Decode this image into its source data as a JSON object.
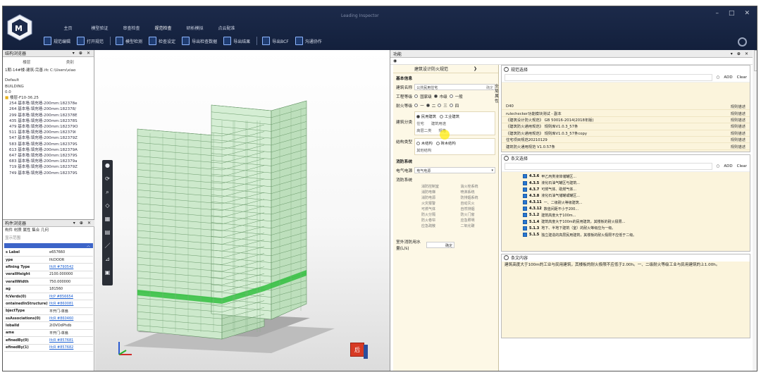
{
  "app": {
    "window_title": "Leading Inspector",
    "menu": [
      "主页",
      "模型验证",
      "审查检查",
      "规范检查",
      "研析模拟",
      "点云配准"
    ],
    "active_menu_index": 3,
    "toolbar": [
      "规范编辑",
      "打开规范",
      "模型检测",
      "检查设定",
      "导出检查数据",
      "导出结果",
      "导出BCF",
      "沟通协作"
    ]
  },
  "left": {
    "tree_title": "结构浏览器",
    "tabs": [
      "楼层",
      "类别"
    ],
    "file_row": "1期-14#楼-建筑-完善.ifc C:\\Users\\xiao",
    "rows": [
      "Default",
      "BUILDING",
      "0.0"
    ],
    "folder": "楼层-F10-36.25",
    "items": [
      "254 基本墙:填充墙-200mm:182378e",
      "264 基本墙:填充墙-200mm:182378/",
      "299 基本墙:填充墙-200mm:182378E",
      "435 基本墙:填充墙-200mm:182378S",
      "479 基本墙:填充墙-200mm:182379O",
      "511 基本墙:填充墙-200mm:182379I",
      "547 基本墙:填充墙-200mm:182379Z",
      "583 基本墙:填充墙-200mm:182379S",
      "613 基本墙:填充墙-200mm:182379A",
      "647 基本墙:填充墙-200mm:182379S",
      "683 基本墙:填充墙-200mm:182379a",
      "719 基本墙:填充墙-200mm:182379Z",
      "749 基本墙:填充墙-200mm:182379S"
    ],
    "props_title": "构件浏览器",
    "props_tabs": "构件 材质 属性 集合 几何",
    "props_sub": "显示范围",
    "properties": [
      {
        "k": "s Label",
        "v": "e657660"
      },
      {
        "k": "ype",
        "v": "IfcDOOR"
      },
      {
        "k": "efining Type",
        "v": "IfcR #790542",
        "link": true
      },
      {
        "k": "verallHeight",
        "v": "2100.000000"
      },
      {
        "k": "verallWidth",
        "v": "750.000000"
      },
      {
        "k": "ag",
        "v": "181560"
      },
      {
        "k": "fcVerds(0)",
        "v": "IfcP #856654",
        "link": true
      },
      {
        "k": "ontainedInStructure(0)",
        "v": "IfcR #860081",
        "link": true
      },
      {
        "k": "bjectType",
        "v": "平开门-单扇"
      },
      {
        "k": "ssAssociations(0)",
        "v": "IfcR #860460",
        "link": true
      },
      {
        "k": "lobalId",
        "v": "2iOVOdPhdb"
      },
      {
        "k": "ame",
        "v": "平开门-单扇"
      },
      {
        "k": "efinedBy(0)",
        "v": "IfcR #857681",
        "link": true
      },
      {
        "k": "efinedBy(1)",
        "v": "IfcR #857682",
        "link": true
      }
    ]
  },
  "check": {
    "panel_title": "功能",
    "form_header": "建筑设计防火规范",
    "side_label": "全局属性",
    "basic_info": "基本信息",
    "building_name_label": "建筑名称",
    "building_name_value": "公共民用住宅",
    "building_name_suffix": "确定",
    "level_label": "工程等级",
    "level_opts": [
      "国家级",
      "市级",
      "一般"
    ],
    "fire_label": "耐火等级",
    "fire_opts": [
      "一",
      "二",
      "三",
      "四"
    ],
    "class_label": "建筑分类",
    "class_opts": [
      "民用建筑",
      "工业建筑"
    ],
    "class_sub": [
      "住宅",
      "建筑用途",
      "高层二类",
      "规格"
    ],
    "struct_label": "结构类型",
    "struct_opts": [
      "木结构",
      "砖木结构"
    ],
    "struct_sub": "其他结构",
    "fire_sys": "消防系统",
    "power_label": "电气电源",
    "power_value": "电气电源",
    "fire_sys_label": "消防系统",
    "fire_items": [
      "消防控制室",
      "消火栓系统",
      "消防电梯",
      "喷淋系统",
      "消防电源",
      "防排烟系统",
      "火灾报警",
      "自动灭火",
      "可燃气体",
      "自然排烟",
      "防火分隔",
      "防火门窗",
      "防火卷帘",
      "应急照明",
      "应急疏散",
      "二氧化碳"
    ],
    "outdoor_label": "室外消防用水量(L/s)",
    "outdoor_suffix": "确定",
    "rules_title": "规范选择",
    "add": "ADD",
    "clear": "Clear",
    "rules": [
      {
        "name": "D40",
        "status": "规则描述"
      },
      {
        "name": "rulechecker功能模块测试 - 副本",
        "status": "规则描述"
      },
      {
        "name": "《建筑设计防火规范》 GB 50016-2014(2018年版)",
        "status": "规则描述"
      },
      {
        "name": "《建筑防火通用规范》 规则库V1.0.3_57条",
        "status": "规则描述"
      },
      {
        "name": "《建筑防火通用规范》 规则库V1.0.3_57条copy",
        "status": "规则描述"
      },
      {
        "name": "住宅项目规范20210129",
        "status": "规则描述"
      },
      {
        "name": "建筑防火通用规范 V1.0.57条",
        "status": "规则描述"
      }
    ],
    "articles_title": "条文选择",
    "articles": [
      {
        "no": "4.3.6",
        "text": "甲乙丙类液体储罐区..."
      },
      {
        "no": "4.3.5",
        "text": "液化石油气罐区与建筑..."
      },
      {
        "no": "4.3.7",
        "text": "可燃气体、助燃气体..."
      },
      {
        "no": "4.3.8",
        "text": "液化石油气储罐或罐区..."
      },
      {
        "no": "4.3.11",
        "text": "一、二级耐火等级建筑..."
      },
      {
        "no": "4.3.12",
        "text": "数值间距不小于200..."
      },
      {
        "no": "5.1.2",
        "text": "建筑高度大于100m..."
      },
      {
        "no": "5.1.4",
        "text": "建筑高度大于100m的民用建筑，其楼板的耐火极限..."
      },
      {
        "no": "5.1.3",
        "text": "地下、半地下建筑（室）的耐火等级应为一级。"
      },
      {
        "no": "5.1.5",
        "text": "独立建造的高层民用建筑，其楼板的耐火极限不应低于二级。"
      }
    ],
    "content_title": "条文内容",
    "content_text": "建筑高度大于100m的工业与民用建筑，其楼板的耐火极限不应低于2.00h。一、二级耐火等级工业与民用建筑的上1.00h。"
  }
}
